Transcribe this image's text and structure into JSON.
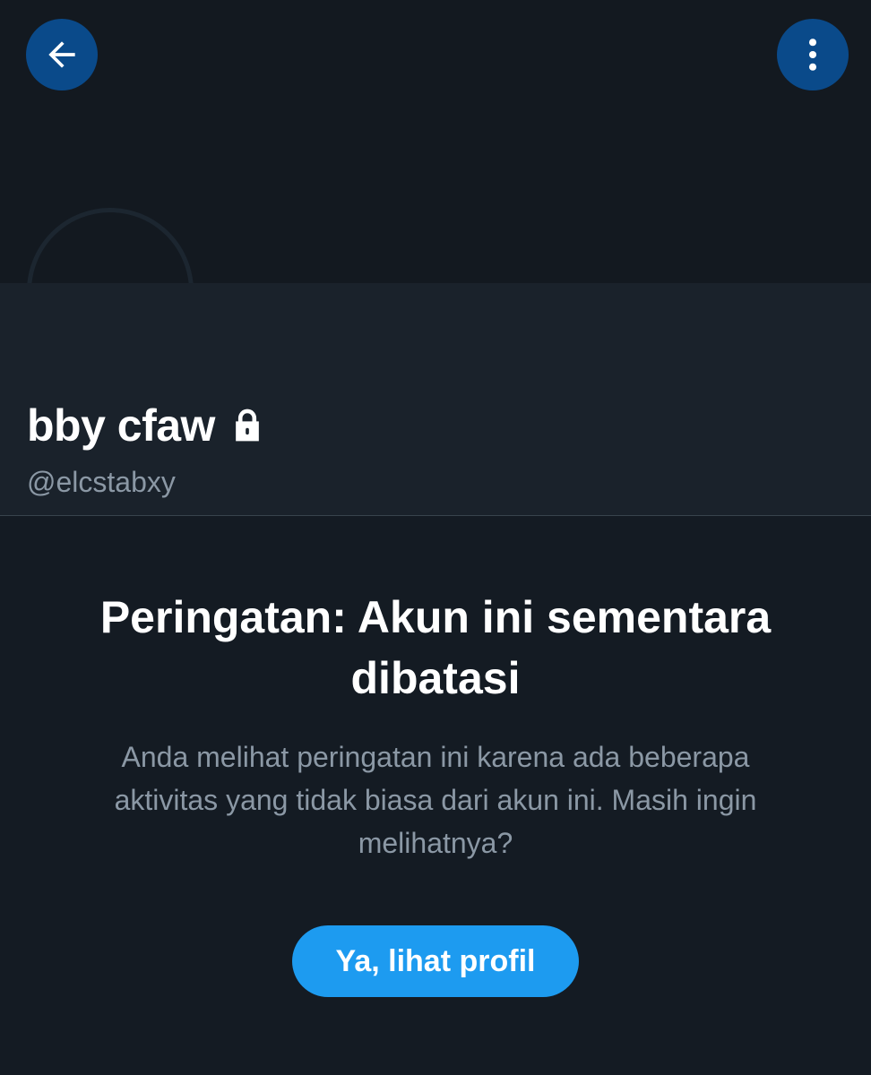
{
  "header": {
    "back_icon": "arrow-left-icon",
    "more_icon": "more-vertical-icon"
  },
  "profile": {
    "display_name": "bby cfaw",
    "protected_icon": "lock-icon",
    "handle": "@elcstabxy"
  },
  "warning": {
    "title": "Peringatan: Akun ini sementara dibatasi",
    "description": "Anda melihat peringatan ini karena ada beberapa aktivitas yang tidak biasa dari akun ini. Masih ingin melihatnya?",
    "button_label": "Ya, lihat profil"
  },
  "colors": {
    "background": "#141b23",
    "button": "#1d9bf0",
    "icon_button": "#0a4a8a",
    "secondary_text": "#8b98a5"
  }
}
